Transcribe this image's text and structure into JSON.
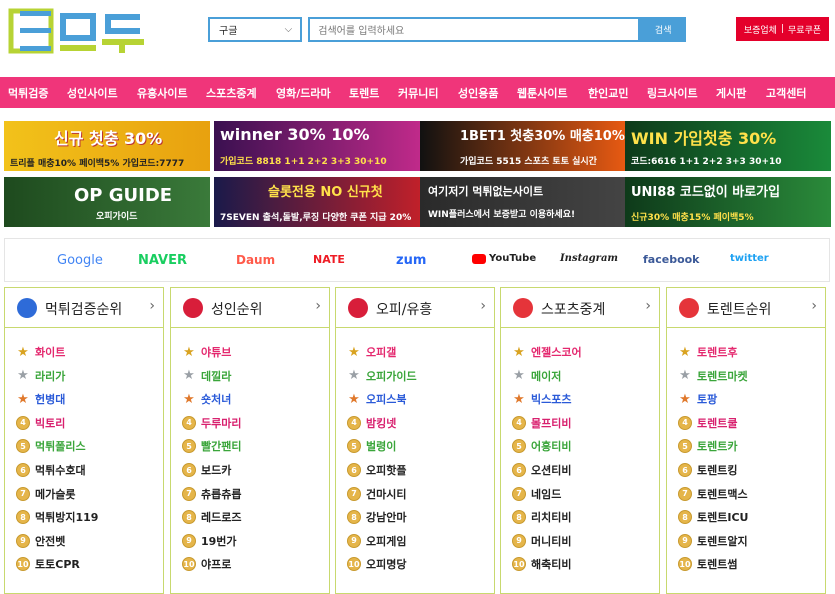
{
  "header": {
    "search_select": "구글",
    "search_placeholder": "검색어를 입력하세요",
    "search_button": "검색",
    "report_label": "보증업체",
    "separator": "|",
    "free_label": "무료쿠폰"
  },
  "nav": [
    "먹튀검증",
    "성인사이트",
    "유흥사이트",
    "스포츠중계",
    "영화/드라마",
    "토렌트",
    "커뮤니티",
    "성인용품",
    "웹툰사이트",
    "한인교민",
    "링크사이트",
    "게시판",
    "고객센터"
  ],
  "banners": [
    {
      "t1": "신규 첫충 30%",
      "t2": "트리플 매충10% 페이백5% 가입코드:7777",
      "bg": "#f2c21a"
    },
    {
      "t1": "winner 30% 10%",
      "t2": "가입코드 8818 1+1 2+2 3+3 30+10",
      "bg": "#7a1e7a"
    },
    {
      "t1": "1BET1 첫충30% 매충10%",
      "t2": "가입코드 5515 스포츠 토토 실시간",
      "bg": "#e85a12"
    },
    {
      "t1": "WIN 가입첫충 30%",
      "t2": "코드:6616 1+1 2+2 3+3 30+10",
      "bg": "#1a8a3a"
    },
    {
      "t1": "OP GUIDE",
      "t2": "오피가이드",
      "bg": "#2e6b2e"
    },
    {
      "t1": "슬롯전용 NO 신규첫",
      "t2": "7SEVEN 출석,돌발,루징 다양한 쿠폰 지급 20%",
      "bg": "#c0202a"
    },
    {
      "t1": "여기저기 먹튀없는사이트",
      "t2": "WIN플러스에서 보증받고 이용하세요!",
      "bg": "#222222"
    },
    {
      "t1": "UNI88 코드없이 바로가입",
      "t2": "신규30% 매충15% 페이백5%",
      "bg": "#2a8a3a"
    }
  ],
  "portals": [
    "Google",
    "NAVER",
    "Daum",
    "NATE",
    "zum",
    "YouTube",
    "Instagram",
    "facebook",
    "twitter"
  ],
  "panels": [
    {
      "title": "먹튀검증순위",
      "items": [
        "화이트",
        "라리가",
        "헌병대",
        "빅토리",
        "먹튀폴리스",
        "먹튀수호대",
        "메가슬롯",
        "먹튀방지119",
        "안전벳",
        "토토CPR"
      ]
    },
    {
      "title": "성인순위",
      "items": [
        "야튜브",
        "데낄라",
        "숏처녀",
        "두루마리",
        "빨간팬티",
        "보드카",
        "츄릅츄릅",
        "레드로즈",
        "19번가",
        "야프로"
      ]
    },
    {
      "title": "오피/유흥",
      "items": [
        "오피갤",
        "오피가이드",
        "오피스북",
        "밤킹넷",
        "벌령이",
        "오피핫플",
        "건마시티",
        "강남안마",
        "오피게임",
        "오피명당"
      ]
    },
    {
      "title": "스포츠중계",
      "items": [
        "엔젤스코어",
        "메이저",
        "빅스포츠",
        "몰프티비",
        "어흥티비",
        "오션티비",
        "네임드",
        "리치티비",
        "머니티비",
        "해축티비"
      ]
    },
    {
      "title": "토렌트순위",
      "items": [
        "토렌트후",
        "토렌트마켓",
        "토팡",
        "토렌트쿨",
        "토렌트카",
        "토렌트킹",
        "토렌트맥스",
        "토렌트ICU",
        "토렌트알지",
        "토렌트썸"
      ]
    }
  ]
}
